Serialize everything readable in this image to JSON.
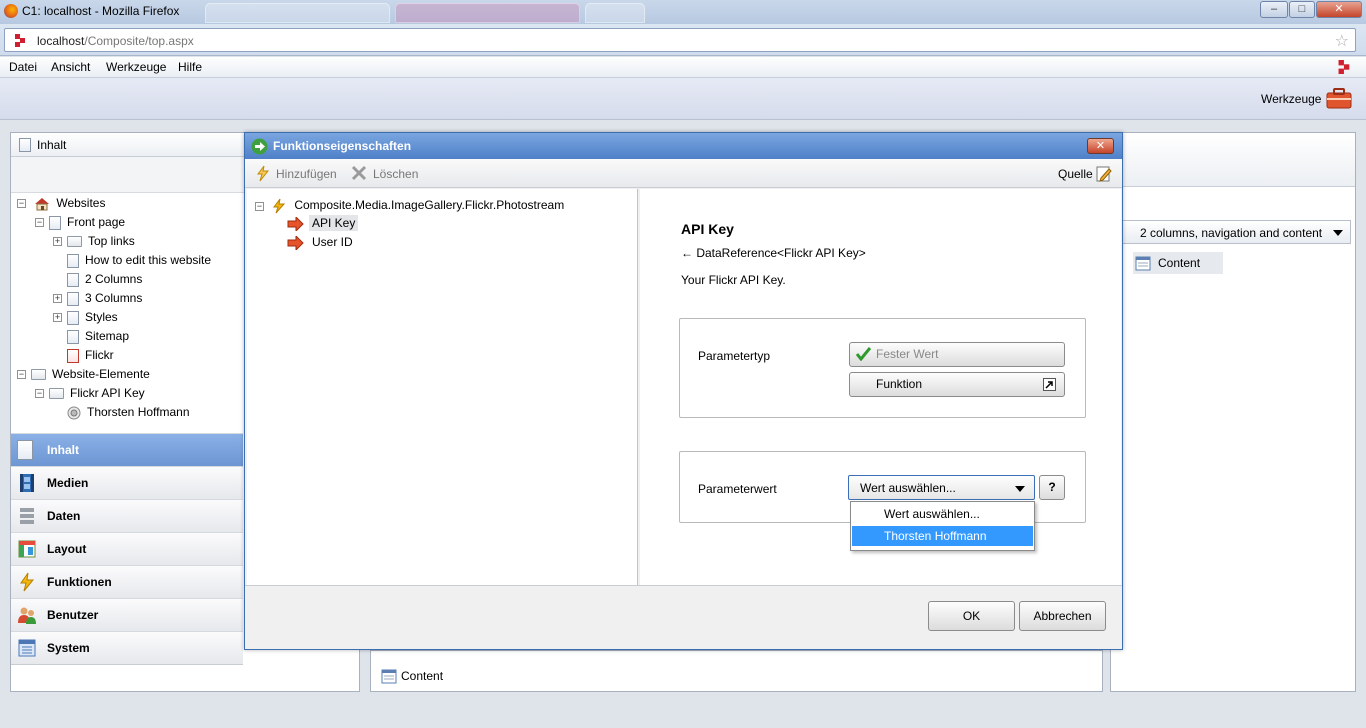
{
  "browser": {
    "title": "C1: localhost - Mozilla Firefox",
    "url_host": "localhost",
    "url_path": "/Composite/top.aspx",
    "menu": [
      "Datei",
      "Ansicht",
      "Werkzeuge",
      "Hilfe"
    ]
  },
  "toolstrip": {
    "tools_label": "Werkzeuge"
  },
  "left_panel": {
    "header": "Inhalt",
    "tree": [
      {
        "label": "Websites"
      },
      {
        "label": "Front page"
      },
      {
        "label": "Top links"
      },
      {
        "label": "How to edit this website"
      },
      {
        "label": "2 Columns"
      },
      {
        "label": "3 Columns"
      },
      {
        "label": "Styles"
      },
      {
        "label": "Sitemap"
      },
      {
        "label": "Flickr"
      },
      {
        "label": "Website-Elemente"
      },
      {
        "label": "Flickr API Key"
      },
      {
        "label": "Thorsten Hoffmann"
      }
    ],
    "nav": [
      "Inhalt",
      "Medien",
      "Daten",
      "Layout",
      "Funktionen",
      "Benutzer",
      "System"
    ]
  },
  "right_panel": {
    "layout_select": "2 columns, navigation and content",
    "content_label": "Content"
  },
  "bottom_panel": {
    "content_label": "Content"
  },
  "dialog": {
    "title": "Funktionseigenschaften",
    "toolbar": {
      "add": "Hinzufügen",
      "delete": "Löschen",
      "source": "Quelle"
    },
    "tree_root": "Composite.Media.ImageGallery.Flickr.Photostream",
    "tree_children": [
      "API Key",
      "User ID"
    ],
    "detail": {
      "heading": "API Key",
      "reference": "← DataReference<Flickr API Key>",
      "description": "Your Flickr API Key.",
      "param_type_label": "Parametertyp",
      "fixed_value_button": "Fester Wert",
      "function_button": "Funktion",
      "param_value_label": "Parameterwert",
      "select_value": "Wert auswählen...",
      "help_button": "?",
      "options": [
        "Wert auswählen...",
        "Thorsten Hoffmann"
      ]
    },
    "ok": "OK",
    "cancel": "Abbrechen"
  },
  "colors": {
    "accent": "#4f80c8",
    "selected_option": "#3399ff",
    "active_nav": "#7aa3dd"
  }
}
